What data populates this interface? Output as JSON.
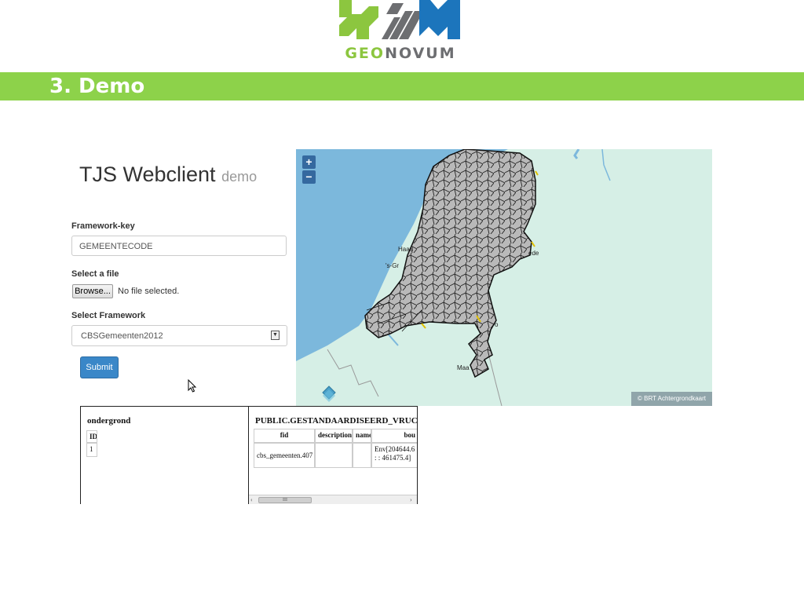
{
  "logo": {
    "text_part1": "GEO",
    "text_part2": "NOVUM"
  },
  "slide": {
    "title": "3. Demo"
  },
  "app": {
    "title": "TJS Webclient",
    "title_suffix": "demo",
    "framework_key_label": "Framework-key",
    "framework_key_value": "GEMEENTECODE",
    "file_label": "Select a file",
    "browse_label": "Browse...",
    "file_status": "No file selected.",
    "framework_label": "Select Framework",
    "framework_value": "CBSGemeenten2012",
    "submit_label": "Submit"
  },
  "map": {
    "zoom_in": "+",
    "zoom_out": "−",
    "attribution": "© BRT Achtergrondkaart",
    "places": [
      "Haarl",
      "'s-Gr",
      "ede",
      "Maa",
      "n",
      "o"
    ]
  },
  "left_panel": {
    "title": "ondergrond",
    "header": "ID",
    "value": "1"
  },
  "right_panel": {
    "title": "PUBLIC.GESTANDAARDISEERD_VRUCHTBA",
    "columns": [
      "fid",
      "description",
      "name",
      "bou"
    ],
    "row": [
      "cbs_gemeenten.407",
      "",
      "",
      "Env[204644.6 : : 461475.4]"
    ],
    "scroll_thumb": "III",
    "scroll_left": "‹",
    "scroll_right": "›"
  },
  "colors": {
    "banner": "#8dd24a",
    "logo_green": "#8cc63f",
    "logo_grey": "#6d6e71",
    "logo_blue": "#1c75bc",
    "sea": "#7cb8dc",
    "land": "#d6efe6",
    "municipalities": "#b7b7b7",
    "button_primary": "#3a87c8"
  }
}
